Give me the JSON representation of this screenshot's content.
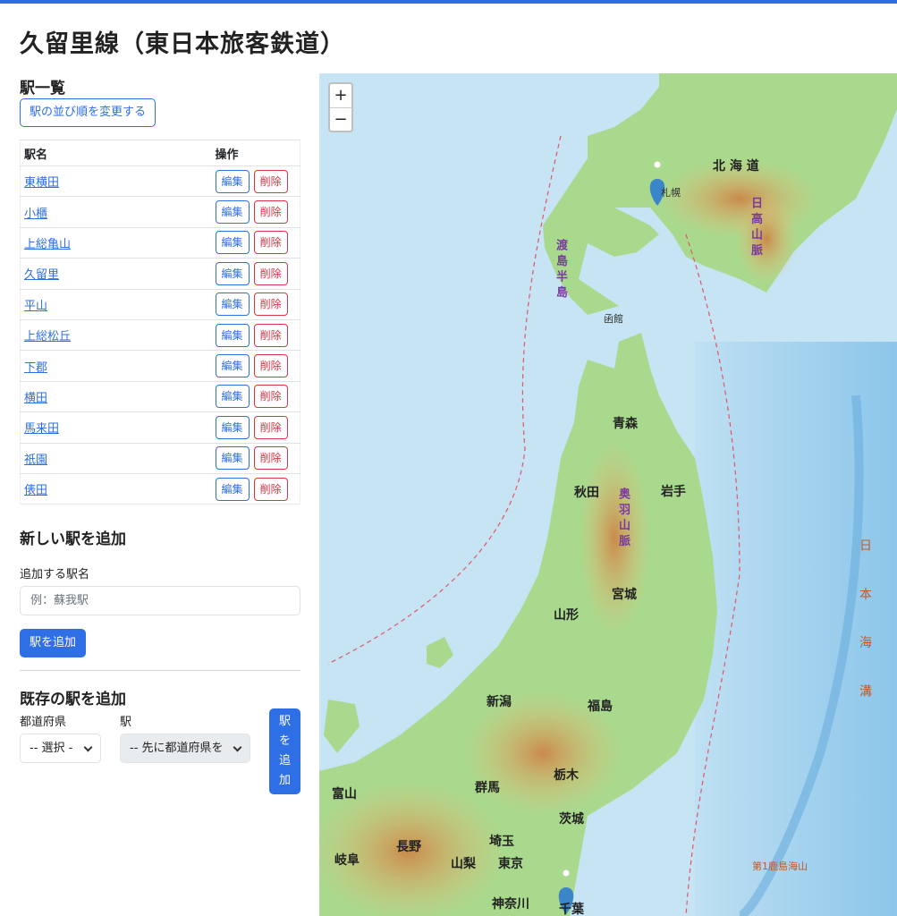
{
  "page": {
    "title": "久留里線（東日本旅客鉄道）"
  },
  "station_list": {
    "heading": "駅一覧",
    "reorder_button": "駅の並び順を変更する",
    "columns": [
      "駅名",
      "操作"
    ],
    "edit_label": "編集",
    "delete_label": "削除",
    "stations": [
      "東横田",
      "小櫃",
      "上総亀山",
      "久留里",
      "平山",
      "上総松丘",
      "下郡",
      "横田",
      "馬来田",
      "祇園",
      "俵田"
    ]
  },
  "new_station": {
    "heading": "新しい駅を追加",
    "field_label": "追加する駅名",
    "placeholder": "例：蘇我駅",
    "submit_label": "駅を追加"
  },
  "existing_station": {
    "heading": "既存の駅を追加",
    "prefecture_label": "都道府県",
    "station_label": "駅",
    "prefecture_value": "-- 選択 -",
    "station_value": "-- 先に都道府県を",
    "submit_label": "駅を追加"
  },
  "map": {
    "zoom_in": "+",
    "zoom_out": "−",
    "labels": {
      "hokkaido": "北 海 道",
      "aomori": "青森",
      "akita": "秋田",
      "iwate": "岩手",
      "miyagi": "宮城",
      "yamagata": "山形",
      "fukushima": "福島",
      "niigata": "新潟",
      "tochigi": "栃木",
      "gunma": "群馬",
      "ibaraki": "茨城",
      "saitama": "埼玉",
      "tokyo": "東京",
      "kanagawa": "神奈川",
      "chiba": "千葉",
      "nagano": "長野",
      "yamanashi": "山梨",
      "toyama": "富山",
      "gifu": "岐阜",
      "sapporo": "札幌",
      "hakodate": "函館",
      "sea_trench": "日 本 海 溝",
      "hidaka": "日 高 山 脈",
      "ou": "奥 羽 山 脈",
      "oshima": "渡 島 半 島",
      "seamount": "第1鹿島海山"
    },
    "colors": {
      "sea": "#bfe0f2",
      "deep_sea": "#8cc6ea",
      "lowland": "#a9d98d",
      "highland": "#e8c27a",
      "mountain": "#c98a4a",
      "marker": "#3a86c8"
    }
  }
}
